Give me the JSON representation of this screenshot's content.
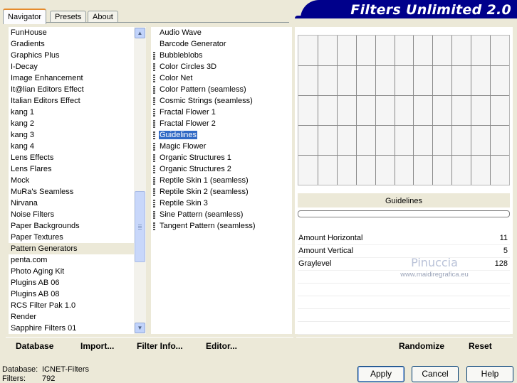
{
  "tabs": [
    {
      "label": "Navigator",
      "active": true
    },
    {
      "label": "Presets",
      "active": false
    },
    {
      "label": "About",
      "active": false
    }
  ],
  "app_title": "Filters Unlimited 2.0",
  "categories": {
    "items": [
      "FunHouse",
      "Gradients",
      "Graphics Plus",
      "I-Decay",
      "Image Enhancement",
      "It@lian Editors Effect",
      "Italian Editors Effect",
      "kang 1",
      "kang 2",
      "kang 3",
      "kang 4",
      "Lens Effects",
      "Lens Flares",
      "Mock",
      "MuRa's Seamless",
      "Nirvana",
      "Noise Filters",
      "Paper Backgrounds",
      "Paper Textures",
      "Pattern Generators",
      "penta.com",
      "Photo Aging Kit",
      "Plugins AB 06",
      "Plugins AB 08",
      "RCS Filter Pak 1.0",
      "Render",
      "Sapphire Filters 01"
    ],
    "selected": "Pattern Generators"
  },
  "filters": {
    "items": [
      {
        "label": "Audio Wave",
        "marked": false
      },
      {
        "label": "Barcode Generator",
        "marked": false
      },
      {
        "label": "Bubbleblobs",
        "marked": true
      },
      {
        "label": "Color Circles 3D",
        "marked": true
      },
      {
        "label": "Color Net",
        "marked": true
      },
      {
        "label": "Color Pattern (seamless)",
        "marked": true
      },
      {
        "label": "Cosmic Strings (seamless)",
        "marked": true
      },
      {
        "label": "Fractal Flower 1",
        "marked": true
      },
      {
        "label": "Fractal Flower 2",
        "marked": true
      },
      {
        "label": "Guidelines",
        "marked": true
      },
      {
        "label": "Magic Flower",
        "marked": true
      },
      {
        "label": "Organic Structures 1",
        "marked": true
      },
      {
        "label": "Organic Structures 2",
        "marked": true
      },
      {
        "label": "Reptile Skin 1 (seamless)",
        "marked": true
      },
      {
        "label": "Reptile Skin 2 (seamless)",
        "marked": true
      },
      {
        "label": "Reptile Skin 3",
        "marked": true
      },
      {
        "label": "Sine Pattern (seamless)",
        "marked": true
      },
      {
        "label": "Tangent Pattern (seamless)",
        "marked": true
      }
    ],
    "selected": "Guidelines"
  },
  "preview": {
    "filter_name": "Guidelines"
  },
  "params": [
    {
      "label": "Amount Horizontal",
      "value": "11"
    },
    {
      "label": "Amount Vertical",
      "value": "5"
    },
    {
      "label": "Graylevel",
      "value": "128"
    }
  ],
  "watermark": {
    "name": "Pinuccia",
    "url": "www.maidiregrafica.eu"
  },
  "toolbar_left": {
    "database": "Database",
    "import": "Import...",
    "filter_info": "Filter Info...",
    "editor": "Editor..."
  },
  "toolbar_right": {
    "randomize": "Randomize",
    "reset": "Reset"
  },
  "status": {
    "database_label": "Database:",
    "database_value": "ICNET-Filters",
    "filters_label": "Filters:",
    "filters_value": "792"
  },
  "buttons": {
    "apply": "Apply",
    "cancel": "Cancel",
    "help": "Help"
  },
  "colors": {
    "banner": "#00008b",
    "selection": "#316ac5",
    "window_bg": "#ece9d8"
  }
}
